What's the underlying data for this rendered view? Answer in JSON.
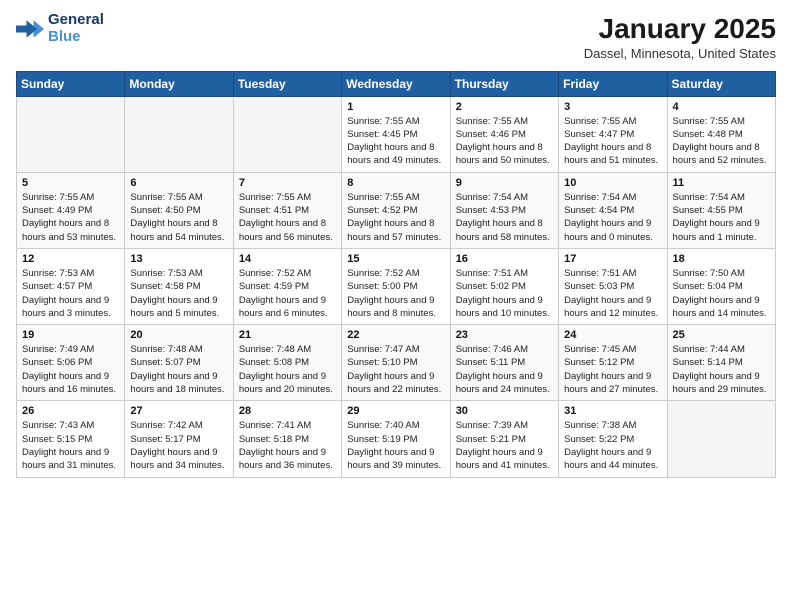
{
  "header": {
    "logo_general": "General",
    "logo_blue": "Blue",
    "main_title": "January 2025",
    "subtitle": "Dassel, Minnesota, United States"
  },
  "calendar": {
    "days_of_week": [
      "Sunday",
      "Monday",
      "Tuesday",
      "Wednesday",
      "Thursday",
      "Friday",
      "Saturday"
    ],
    "weeks": [
      [
        {
          "day": "",
          "empty": true
        },
        {
          "day": "",
          "empty": true
        },
        {
          "day": "",
          "empty": true
        },
        {
          "day": "1",
          "sunrise": "7:55 AM",
          "sunset": "4:45 PM",
          "daylight": "8 hours and 49 minutes."
        },
        {
          "day": "2",
          "sunrise": "7:55 AM",
          "sunset": "4:46 PM",
          "daylight": "8 hours and 50 minutes."
        },
        {
          "day": "3",
          "sunrise": "7:55 AM",
          "sunset": "4:47 PM",
          "daylight": "8 hours and 51 minutes."
        },
        {
          "day": "4",
          "sunrise": "7:55 AM",
          "sunset": "4:48 PM",
          "daylight": "8 hours and 52 minutes."
        }
      ],
      [
        {
          "day": "5",
          "sunrise": "7:55 AM",
          "sunset": "4:49 PM",
          "daylight": "8 hours and 53 minutes."
        },
        {
          "day": "6",
          "sunrise": "7:55 AM",
          "sunset": "4:50 PM",
          "daylight": "8 hours and 54 minutes."
        },
        {
          "day": "7",
          "sunrise": "7:55 AM",
          "sunset": "4:51 PM",
          "daylight": "8 hours and 56 minutes."
        },
        {
          "day": "8",
          "sunrise": "7:55 AM",
          "sunset": "4:52 PM",
          "daylight": "8 hours and 57 minutes."
        },
        {
          "day": "9",
          "sunrise": "7:54 AM",
          "sunset": "4:53 PM",
          "daylight": "8 hours and 58 minutes."
        },
        {
          "day": "10",
          "sunrise": "7:54 AM",
          "sunset": "4:54 PM",
          "daylight": "9 hours and 0 minutes."
        },
        {
          "day": "11",
          "sunrise": "7:54 AM",
          "sunset": "4:55 PM",
          "daylight": "9 hours and 1 minute."
        }
      ],
      [
        {
          "day": "12",
          "sunrise": "7:53 AM",
          "sunset": "4:57 PM",
          "daylight": "9 hours and 3 minutes."
        },
        {
          "day": "13",
          "sunrise": "7:53 AM",
          "sunset": "4:58 PM",
          "daylight": "9 hours and 5 minutes."
        },
        {
          "day": "14",
          "sunrise": "7:52 AM",
          "sunset": "4:59 PM",
          "daylight": "9 hours and 6 minutes."
        },
        {
          "day": "15",
          "sunrise": "7:52 AM",
          "sunset": "5:00 PM",
          "daylight": "9 hours and 8 minutes."
        },
        {
          "day": "16",
          "sunrise": "7:51 AM",
          "sunset": "5:02 PM",
          "daylight": "9 hours and 10 minutes."
        },
        {
          "day": "17",
          "sunrise": "7:51 AM",
          "sunset": "5:03 PM",
          "daylight": "9 hours and 12 minutes."
        },
        {
          "day": "18",
          "sunrise": "7:50 AM",
          "sunset": "5:04 PM",
          "daylight": "9 hours and 14 minutes."
        }
      ],
      [
        {
          "day": "19",
          "sunrise": "7:49 AM",
          "sunset": "5:06 PM",
          "daylight": "9 hours and 16 minutes."
        },
        {
          "day": "20",
          "sunrise": "7:48 AM",
          "sunset": "5:07 PM",
          "daylight": "9 hours and 18 minutes."
        },
        {
          "day": "21",
          "sunrise": "7:48 AM",
          "sunset": "5:08 PM",
          "daylight": "9 hours and 20 minutes."
        },
        {
          "day": "22",
          "sunrise": "7:47 AM",
          "sunset": "5:10 PM",
          "daylight": "9 hours and 22 minutes."
        },
        {
          "day": "23",
          "sunrise": "7:46 AM",
          "sunset": "5:11 PM",
          "daylight": "9 hours and 24 minutes."
        },
        {
          "day": "24",
          "sunrise": "7:45 AM",
          "sunset": "5:12 PM",
          "daylight": "9 hours and 27 minutes."
        },
        {
          "day": "25",
          "sunrise": "7:44 AM",
          "sunset": "5:14 PM",
          "daylight": "9 hours and 29 minutes."
        }
      ],
      [
        {
          "day": "26",
          "sunrise": "7:43 AM",
          "sunset": "5:15 PM",
          "daylight": "9 hours and 31 minutes."
        },
        {
          "day": "27",
          "sunrise": "7:42 AM",
          "sunset": "5:17 PM",
          "daylight": "9 hours and 34 minutes."
        },
        {
          "day": "28",
          "sunrise": "7:41 AM",
          "sunset": "5:18 PM",
          "daylight": "9 hours and 36 minutes."
        },
        {
          "day": "29",
          "sunrise": "7:40 AM",
          "sunset": "5:19 PM",
          "daylight": "9 hours and 39 minutes."
        },
        {
          "day": "30",
          "sunrise": "7:39 AM",
          "sunset": "5:21 PM",
          "daylight": "9 hours and 41 minutes."
        },
        {
          "day": "31",
          "sunrise": "7:38 AM",
          "sunset": "5:22 PM",
          "daylight": "9 hours and 44 minutes."
        },
        {
          "day": "",
          "empty": true
        }
      ]
    ]
  }
}
